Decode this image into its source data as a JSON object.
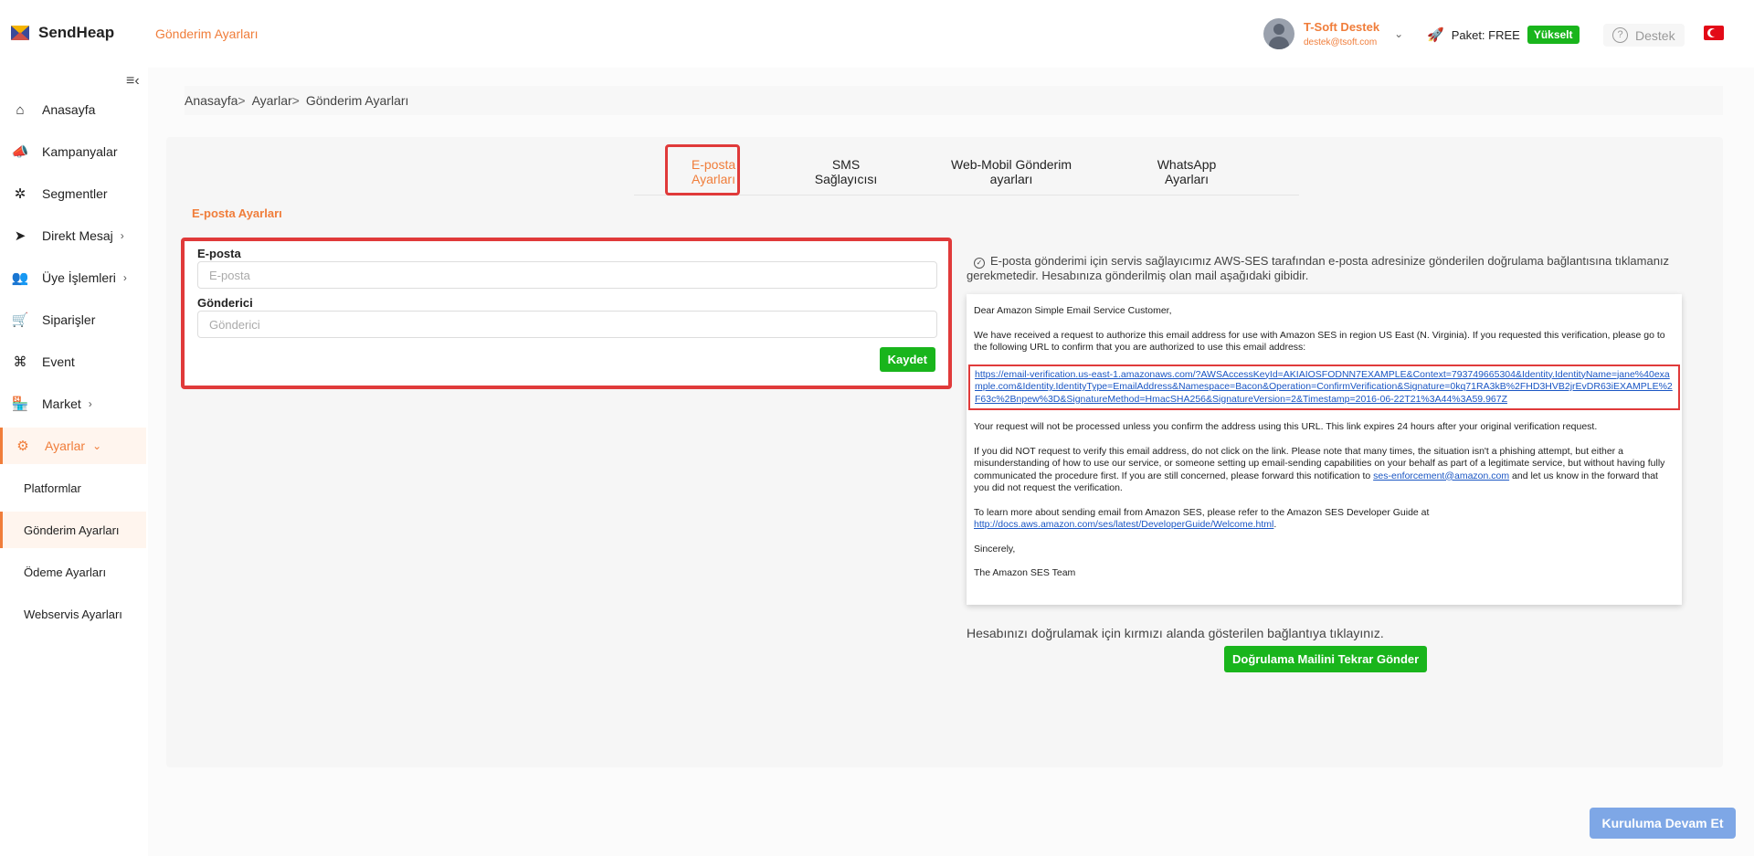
{
  "app": {
    "name": "SendHeap",
    "page_title": "Gönderim Ayarları"
  },
  "user": {
    "name": "T-Soft Destek",
    "email": "destek@tsoft.com"
  },
  "package": {
    "label": "Paket: FREE",
    "upgrade": "Yükselt"
  },
  "support": {
    "label": "Destek"
  },
  "sidebar": {
    "items": [
      {
        "label": "Anasayfa",
        "icon": "home-icon"
      },
      {
        "label": "Kampanyalar",
        "icon": "megaphone-icon"
      },
      {
        "label": "Segmentler",
        "icon": "segments-icon"
      },
      {
        "label": "Direkt Mesaj",
        "icon": "send-icon"
      },
      {
        "label": "Üye İşlemleri",
        "icon": "users-icon"
      },
      {
        "label": "Siparişler",
        "icon": "cart-icon"
      },
      {
        "label": "Event",
        "icon": "command-icon"
      },
      {
        "label": "Market",
        "icon": "store-icon"
      },
      {
        "label": "Ayarlar",
        "icon": "gear-icon"
      }
    ],
    "sub_items": [
      {
        "label": "Platformlar"
      },
      {
        "label": "Gönderim Ayarları"
      },
      {
        "label": "Ödeme Ayarları"
      },
      {
        "label": "Webservis Ayarları"
      }
    ]
  },
  "breadcrumb": {
    "home": "Anasayfa",
    "settings": "Ayarlar",
    "current": "Gönderim Ayarları"
  },
  "tabs": [
    {
      "line1": "E-posta",
      "line2": "Ayarları"
    },
    {
      "line1": "SMS",
      "line2": "Sağlayıcısı"
    },
    {
      "line1": "Web-Mobil Gönderim",
      "line2": "ayarları"
    },
    {
      "line1": "WhatsApp",
      "line2": "Ayarları"
    }
  ],
  "section_title": "E-posta Ayarları",
  "form": {
    "email_label": "E-posta",
    "email_placeholder": "E-posta",
    "sender_label": "Gönderici",
    "sender_placeholder": "Gönderici",
    "save": "Kaydet"
  },
  "info_text": "E-posta gönderimi için servis sağlayıcımız AWS-SES tarafından e-posta adresinize gönderilen doğrulama bağlantısına tıklamanız gerekmetedir. Hesabınıza gönderilmiş olan mail aşağıdaki gibidir.",
  "email_sample": {
    "greeting": "Dear Amazon Simple Email Service Customer,",
    "p1": "We have received a request to authorize this email address for use with Amazon SES in region US East (N. Virginia). If you requested this verification, please go to the following URL to confirm that you are authorized to use this email address:",
    "link": "https://email-verification.us-east-1.amazonaws.com/?AWSAccessKeyId=AKIAIOSFODNN7EXAMPLE&Context=793749665304&Identity.IdentityName=jane%40example.com&Identity.IdentityType=EmailAddress&Namespace=Bacon&Operation=ConfirmVerification&Signature=0kq71RA3kB%2FHD3HVB2jrEvDR63iEXAMPLE%2F63c%2Bnpew%3D&SignatureMethod=HmacSHA256&SignatureVersion=2&Timestamp=2016-06-22T21%3A44%3A59.967Z",
    "p2": "Your request will not be processed unless you confirm the address using this URL. This link expires 24 hours after your original verification request.",
    "p3a": "If you did NOT request to verify this email address, do not click on the link. Please note that many times, the situation isn't a phishing attempt, but either a misunderstanding of how to use our service, or someone setting up email-sending capabilities on your behalf as part of a legitimate service, but without having fully communicated the procedure first. If you are still concerned, please forward this notification to ",
    "p3_link": "ses-enforcement@amazon.com",
    "p3b": " and let us know in the forward that you did not request the verification.",
    "p4a": "To learn more about sending email from Amazon SES, please refer to the Amazon SES Developer Guide at ",
    "p4_link": "http://docs.aws.amazon.com/ses/latest/DeveloperGuide/Welcome.html",
    "p4b": ".",
    "closing": "Sincerely,",
    "team": "The Amazon SES Team"
  },
  "verify_note": "Hesabınızı doğrulamak için kırmızı alanda gösterilen bağlantıya tıklayınız.",
  "resend_button": "Doğrulama Mailini Tekrar Gönder",
  "continue_button": "Kuruluma Devam Et",
  "colors": {
    "accent": "#f07d3a",
    "success": "#19b51c",
    "highlight": "#e03a3a",
    "link": "#1a56c4"
  }
}
